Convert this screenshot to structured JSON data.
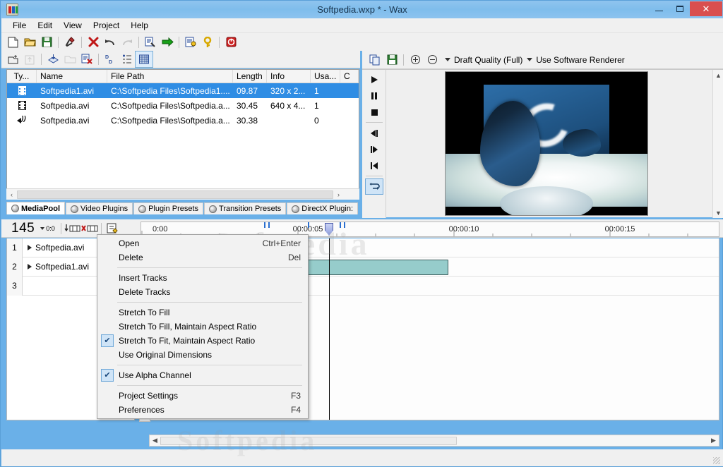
{
  "window": {
    "title": "Softpedia.wxp * - Wax",
    "icon": "wax-app-icon",
    "minimize_label": "–",
    "maximize_label": "□",
    "close_label": "✕"
  },
  "menubar": {
    "items": [
      {
        "label": "File"
      },
      {
        "label": "Edit"
      },
      {
        "label": "View"
      },
      {
        "label": "Project"
      },
      {
        "label": "Help"
      }
    ]
  },
  "toolbar_main": {
    "buttons": [
      {
        "name": "new-project-icon",
        "glyph": "🗋"
      },
      {
        "name": "open-project-icon",
        "glyph": "📂"
      },
      {
        "name": "save-project-icon",
        "glyph": "💾"
      },
      {
        "name": "build-icon",
        "glyph": "🔨"
      },
      {
        "name": "delete-icon",
        "glyph": "✕"
      },
      {
        "name": "undo-icon",
        "glyph": "↶"
      },
      {
        "name": "redo-icon",
        "glyph": "↷"
      },
      {
        "name": "render-preview-icon",
        "glyph": "🗎"
      },
      {
        "name": "export-icon",
        "glyph": "➜"
      },
      {
        "name": "project-settings-icon",
        "glyph": "📝"
      },
      {
        "name": "help-icon",
        "glyph": "?"
      },
      {
        "name": "record-icon",
        "glyph": "◉"
      }
    ]
  },
  "toolbar_mediapool": {
    "buttons": [
      {
        "name": "add-media-icon",
        "glyph": "🗂"
      },
      {
        "name": "up-folder-icon",
        "glyph": "⬆"
      },
      {
        "name": "import-layers-icon",
        "glyph": "🗃"
      },
      {
        "name": "open-folder-icon",
        "glyph": "📁"
      },
      {
        "name": "remove-media-icon",
        "glyph": "🗑"
      },
      {
        "name": "sort-by-name-icon",
        "glyph": "D"
      },
      {
        "name": "list-view-icon",
        "glyph": "≣"
      },
      {
        "name": "details-view-icon",
        "glyph": "▦"
      }
    ]
  },
  "mediapool": {
    "columns": [
      "Ty...",
      "Name",
      "File Path",
      "Length",
      "Info",
      "Usa...",
      "C"
    ],
    "rows": [
      {
        "type_icon": "film-icon",
        "name": "Softpedia1.avi",
        "path": "C:\\Softpedia Files\\Softpedia1....",
        "length": "09.87",
        "info": "320 x 2...",
        "usage": "1",
        "c": "",
        "selected": true
      },
      {
        "type_icon": "film-icon",
        "name": "Softpedia.avi",
        "path": "C:\\Softpedia Files\\Softpedia.a...",
        "length": "30.45",
        "info": "640 x 4...",
        "usage": "1",
        "c": "",
        "selected": false
      },
      {
        "type_icon": "audio-icon",
        "name": "Softpedia.avi",
        "path": "C:\\Softpedia Files\\Softpedia.a...",
        "length": "30.38",
        "info": "",
        "usage": "0",
        "c": "",
        "selected": false
      }
    ],
    "scroll_left_label": "‹",
    "scroll_right_label": "›"
  },
  "tabs": {
    "items": [
      {
        "label": "MediaPool",
        "active": true
      },
      {
        "label": "Video Plugins",
        "active": false
      },
      {
        "label": "Plugin Presets",
        "active": false
      },
      {
        "label": "Transition Presets",
        "active": false
      },
      {
        "label": "DirectX Plugin:",
        "active": false
      }
    ],
    "scroll_prev": "◁",
    "scroll_next": "▶"
  },
  "preview": {
    "toolbar": {
      "copy_frame_icon": "copy-frame-icon",
      "save_frame_icon": "save-frame-icon",
      "zoom_in_icon": "⊕",
      "zoom_out_icon": "⊖",
      "quality_label": "Draft Quality (Full)",
      "renderer_label": "Use Software Renderer"
    },
    "transport": [
      {
        "name": "play-button",
        "glyph": "▶",
        "active": false
      },
      {
        "name": "pause-button",
        "glyph": "❙❙",
        "active": false
      },
      {
        "name": "stop-button",
        "glyph": "■",
        "active": false
      },
      {
        "name": "step-back-button",
        "glyph": "◀❘",
        "active": false
      },
      {
        "name": "step-forward-button",
        "glyph": "❘▶",
        "active": false
      },
      {
        "name": "go-to-start-button",
        "glyph": "❘◀",
        "active": false
      },
      {
        "name": "loop-button",
        "glyph": "↻",
        "active": true
      }
    ],
    "scroll_up": "▲",
    "scroll_down": "▼"
  },
  "timeline_toolbar": {
    "zoom_value": "145",
    "snap_label": "0:0",
    "buttons": [
      {
        "name": "insert-track-icon",
        "glyph": "↓"
      },
      {
        "name": "delete-track-icon",
        "glyph": "✕"
      },
      {
        "name": "edit-properties-icon",
        "glyph": "🗎"
      }
    ]
  },
  "ruler": {
    "start_label": "0:00",
    "labels": [
      {
        "text": "00:00:05",
        "x": 0.285
      },
      {
        "text": "00:00:10",
        "x": 0.555
      },
      {
        "text": "00:00:15",
        "x": 0.825
      }
    ],
    "marks": [
      0.212,
      0.219,
      0.287,
      0.327,
      0.335,
      0.343
    ],
    "playhead_pos": 0.3245
  },
  "tracks": {
    "rows": [
      {
        "number": "1",
        "label": "Softpedia.avi"
      },
      {
        "number": "2",
        "label": "Softpedia1.avi"
      },
      {
        "number": "3",
        "label": ""
      }
    ],
    "clips": [
      {
        "name": "clip-softpedia1",
        "lane": 1,
        "left_pct": 3.0,
        "width_pct": 25.0,
        "color": "#96cccb"
      }
    ],
    "playhead_pct": 32.45
  },
  "context_menu": {
    "items": [
      {
        "label": "Open",
        "accel": "Ctrl+Enter",
        "checked": false,
        "type": "item"
      },
      {
        "label": "Delete",
        "accel": "Del",
        "checked": false,
        "type": "item"
      },
      {
        "type": "separator"
      },
      {
        "label": "Insert Tracks",
        "accel": "",
        "checked": false,
        "type": "item"
      },
      {
        "label": "Delete Tracks",
        "accel": "",
        "checked": false,
        "type": "item"
      },
      {
        "type": "separator"
      },
      {
        "label": "Stretch To Fill",
        "accel": "",
        "checked": false,
        "type": "item"
      },
      {
        "label": "Stretch To Fill, Maintain Aspect Ratio",
        "accel": "",
        "checked": false,
        "type": "item"
      },
      {
        "label": "Stretch To Fit, Maintain Aspect Ratio",
        "accel": "",
        "checked": true,
        "type": "item"
      },
      {
        "label": "Use Original Dimensions",
        "accel": "",
        "checked": false,
        "type": "item"
      },
      {
        "type": "separator"
      },
      {
        "label": "Use Alpha Channel",
        "accel": "",
        "checked": true,
        "type": "item"
      },
      {
        "type": "separator"
      },
      {
        "label": "Project Settings",
        "accel": "F3",
        "checked": false,
        "type": "item"
      },
      {
        "label": "Preferences",
        "accel": "F4",
        "checked": false,
        "type": "item"
      }
    ],
    "check_glyph": "✔"
  },
  "scrollbars": {
    "left_arrow": "◀",
    "right_arrow": "▶",
    "up_arrow": "▲",
    "down_arrow": "▼"
  },
  "watermark": {
    "text": "Softpedia"
  },
  "colors": {
    "title_bar": "#8cc3ef",
    "selection": "#2f8de4",
    "clip": "#96cccb",
    "close_button": "#d94f4f",
    "accent": "#6fa8d8"
  }
}
